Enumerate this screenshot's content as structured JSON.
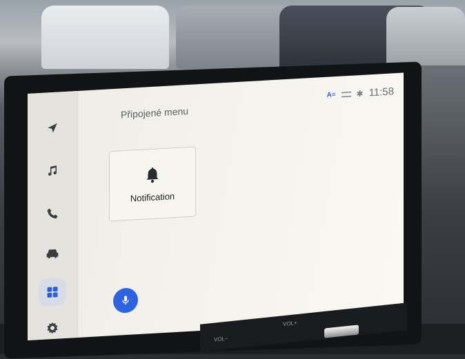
{
  "header": {
    "title": "Připojené menu"
  },
  "status_bar": {
    "time": "11:58"
  },
  "sidebar": {
    "items": [
      {
        "icon": "navigation-icon"
      },
      {
        "icon": "music-icon"
      },
      {
        "icon": "phone-icon"
      },
      {
        "icon": "car-icon"
      },
      {
        "icon": "apps-grid-icon",
        "active": true
      },
      {
        "icon": "settings-icon"
      }
    ]
  },
  "tiles": [
    {
      "icon": "bell-icon",
      "label": "Notification"
    }
  ],
  "voice": {
    "icon": "microphone-icon"
  },
  "hardware": {
    "vol_minus": "VOL−",
    "vol_plus": "VOL+"
  },
  "colors": {
    "accent": "#2f62e0",
    "screen_bg": "#f4f2ec"
  }
}
